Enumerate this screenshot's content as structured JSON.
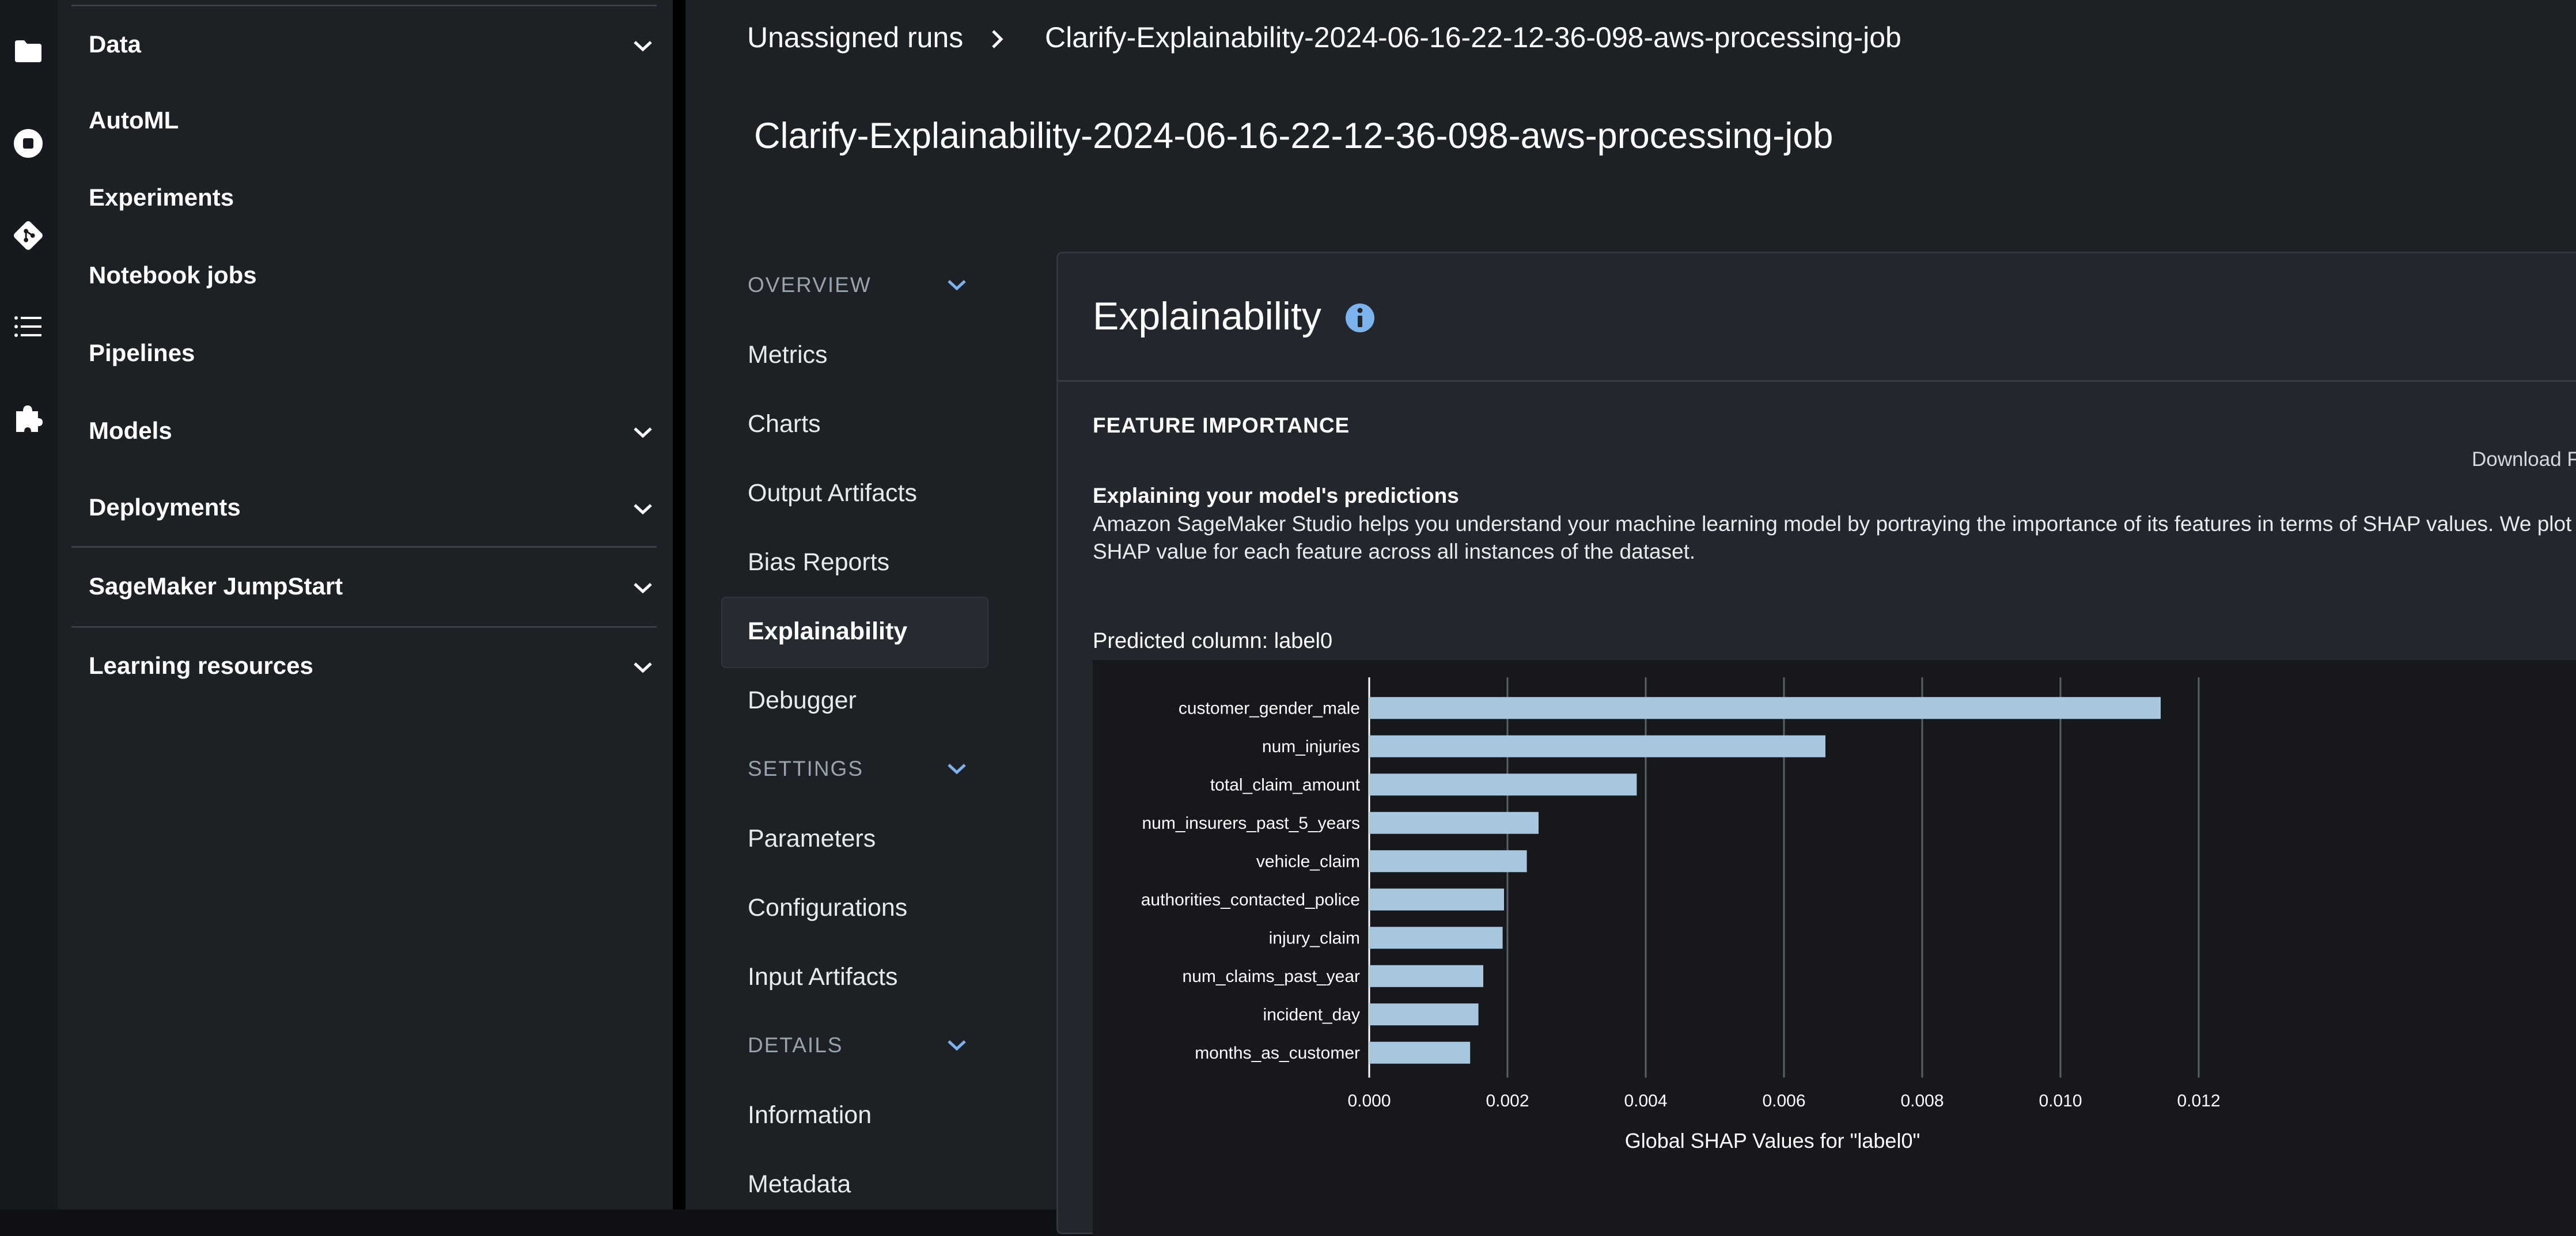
{
  "sidebar": {
    "items": [
      {
        "label": "Data",
        "expandable": true
      },
      {
        "label": "AutoML",
        "expandable": false
      },
      {
        "label": "Experiments",
        "expandable": false
      },
      {
        "label": "Notebook jobs",
        "expandable": false
      },
      {
        "label": "Pipelines",
        "expandable": false
      },
      {
        "label": "Models",
        "expandable": true
      },
      {
        "label": "Deployments",
        "expandable": true
      },
      {
        "label": "SageMaker JumpStart",
        "expandable": true
      },
      {
        "label": "Learning resources",
        "expandable": true
      }
    ]
  },
  "activity_bar": {
    "icons": [
      "folder-icon",
      "stop-circle-icon",
      "git-icon",
      "list-icon",
      "puzzle-icon"
    ]
  },
  "breadcrumb": {
    "items": [
      "Unassigned runs",
      "Clarify-Explainability-2024-06-16-22-12-36-098-aws-processing-job"
    ]
  },
  "page_title": "Clarify-Explainability-2024-06-16-22-12-36-098-aws-processing-job",
  "nav": {
    "overview_label": "OVERVIEW",
    "overview_items": [
      "Metrics",
      "Charts",
      "Output Artifacts",
      "Bias Reports",
      "Explainability",
      "Debugger"
    ],
    "settings_label": "SETTINGS",
    "settings_items": [
      "Parameters",
      "Configurations",
      "Input Artifacts"
    ],
    "details_label": "DETAILS",
    "details_items": [
      "Information",
      "Metadata"
    ],
    "active": "Explainability"
  },
  "panel": {
    "title": "Explainability",
    "section_heading": "FEATURE IMPORTANCE",
    "download_label": "Download F",
    "desc_title": "Explaining your model's predictions",
    "desc_text": "Amazon SageMaker Studio helps you understand your machine learning model by portraying the importance of its features in terms of SHAP values. We plot SHAP value for each feature across all instances of the dataset.",
    "predicted_column": "Predicted column: label0"
  },
  "colors": {
    "bar": "#a7c7e0",
    "accent": "#7cb3ee",
    "background": "#1d2025"
  },
  "chart_data": {
    "type": "bar",
    "orientation": "horizontal",
    "categories": [
      "customer_gender_male",
      "num_injuries",
      "total_claim_amount",
      "num_insurers_past_5_years",
      "vehicle_claim",
      "authorities_contacted_police",
      "injury_claim",
      "num_claims_past_year",
      "incident_day",
      "months_as_customer"
    ],
    "values": [
      0.01145,
      0.0066,
      0.00387,
      0.00245,
      0.00228,
      0.00195,
      0.00193,
      0.00165,
      0.00158,
      0.00146
    ],
    "xlabel": "Global SHAP Values for \"label0\"",
    "ylabel": "",
    "xlim": [
      0,
      0.012
    ],
    "xticks": [
      "0.000",
      "0.002",
      "0.004",
      "0.006",
      "0.008",
      "0.010",
      "0.012"
    ],
    "grid": "vertical"
  }
}
